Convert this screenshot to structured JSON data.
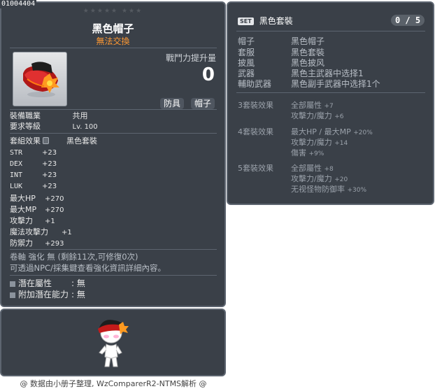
{
  "item_id": "01004404",
  "stars": "★★★★★  ★★★",
  "item": {
    "name": "黑色帽子",
    "trade": "無法交換",
    "attack_power_label": "戰鬥力提升量",
    "attack_power_value": "0",
    "tags": [
      "防具",
      "帽子"
    ],
    "job_label": "裝備職業",
    "job_value": "共用",
    "level_label": "要求等級",
    "level_value": "Lv. 100",
    "set_label": "套組效果",
    "set_value": "黑色套裝",
    "stats": [
      {
        "name": "STR",
        "value": "+23"
      },
      {
        "name": "DEX",
        "value": "+23"
      },
      {
        "name": "INT",
        "value": "+23"
      },
      {
        "name": "LUK",
        "value": "+23"
      },
      {
        "name": "最大HP",
        "value": "+270"
      },
      {
        "name": "最大MP",
        "value": "+270"
      },
      {
        "name": "攻擊力",
        "value": "+1"
      },
      {
        "name": "魔法攻擊力",
        "value": "+1"
      },
      {
        "name": "防禦力",
        "value": "+293"
      }
    ],
    "scroll_line": "卷軸 強化 無 (剩餘11次,可修復0次)",
    "hint_line": "可透過NPC/採集鍵查看強化資訊詳細內容。",
    "potential_label": "潛在屬性",
    "potential_value": ": 無",
    "bonus_potential_label": "附加潛在能力",
    "bonus_potential_value": ": 無"
  },
  "footer": "@ 数据由小册子整理, WzComparerR2-NTMS解析 @",
  "set_panel": {
    "badge": "SET",
    "title": "黑色套裝",
    "count": "0 / 5",
    "pieces": [
      {
        "slot": "帽子",
        "item": "黑色帽子"
      },
      {
        "slot": "套服",
        "item": "黑色套裝"
      },
      {
        "slot": "披風",
        "item": "黑色披风"
      },
      {
        "slot": "武器",
        "item": "黑色主武器中选择1"
      },
      {
        "slot": "輔助武器",
        "item": "黑色副手武器中选择1个"
      }
    ],
    "effects": [
      {
        "label": "3套裝效果",
        "lines": [
          {
            "t": "全部屬性",
            "v": "+7"
          },
          {
            "t": "攻擊力/魔力",
            "v": "+6"
          }
        ]
      },
      {
        "label": "4套裝效果",
        "lines": [
          {
            "t": "最大HP / 最大MP",
            "v": "+20%"
          },
          {
            "t": "攻擊力/魔力",
            "v": "+14"
          },
          {
            "t": "傷害",
            "v": "+9%"
          }
        ]
      },
      {
        "label": "5套裝效果",
        "lines": [
          {
            "t": "全部屬性",
            "v": "+8"
          },
          {
            "t": "攻擊力/魔力",
            "v": "+20"
          },
          {
            "t": "无视怪物防御率",
            "v": "+30%"
          }
        ]
      }
    ]
  },
  "colors": {
    "panel_bg": "#3a4048",
    "panel_border": "#5d6570",
    "untradeable": "#ff9933"
  }
}
